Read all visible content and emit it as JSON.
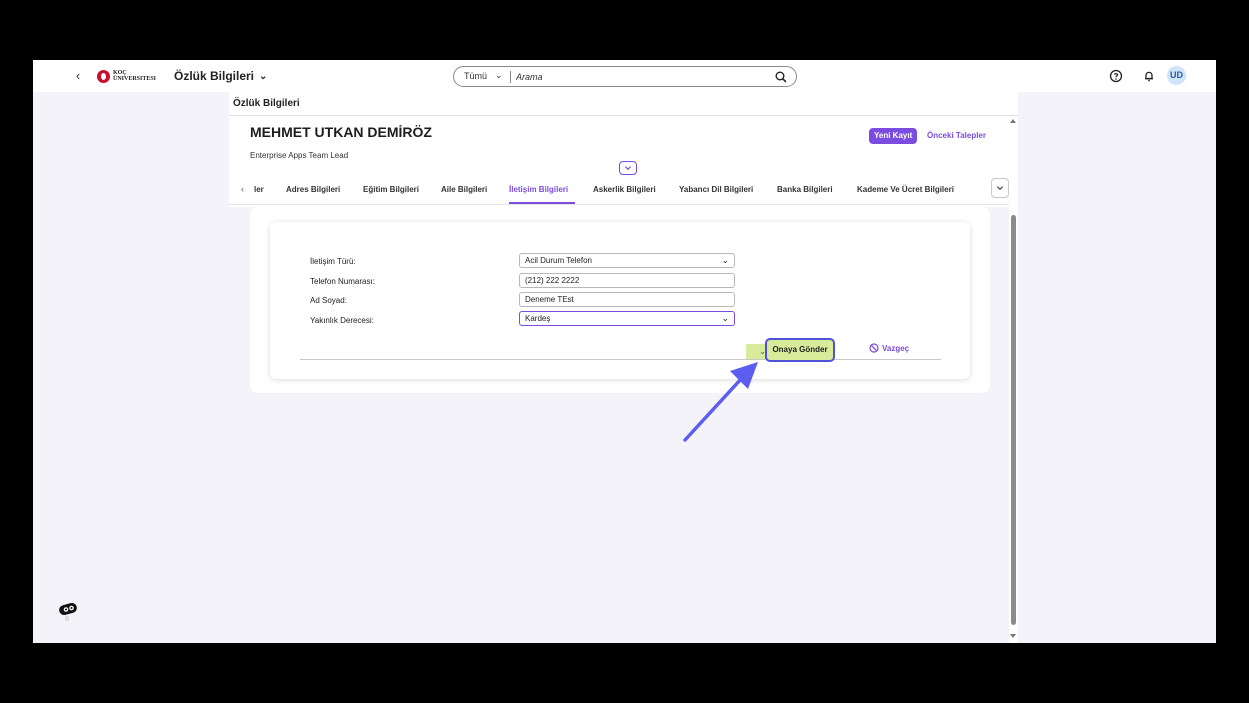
{
  "shell": {
    "back_label": "‹",
    "logo_line1": "KOÇ",
    "logo_line2": "ÜNIVERSITESI",
    "app_title": "Özlük Bilgileri",
    "app_title_chevron": "⌄",
    "search_scope": "Tümü",
    "search_scope_chevron": "⌄",
    "search_placeholder": "Arama",
    "avatar_initials": "UD"
  },
  "page": {
    "title": "Özlük Bilgileri"
  },
  "header": {
    "employee_name": "MEHMET UTKAN DEMİRÖZ",
    "employee_role": "Enterprise Apps Team Lead",
    "new_record_label": "Yeni Kayıt",
    "previous_requests_label": "Önceki Talepler"
  },
  "tabs": {
    "prev_arrow": "‹",
    "partial_label": "ler",
    "items": [
      {
        "label": "Adres Bilgileri"
      },
      {
        "label": "Eğitim Bilgileri"
      },
      {
        "label": "Aile Bilgileri"
      },
      {
        "label": "İletişim Bilgileri",
        "active": true
      },
      {
        "label": "Askerlik Bilgileri"
      },
      {
        "label": "Yabancı Dil Bilgileri"
      },
      {
        "label": "Banka Bilgileri"
      },
      {
        "label": "Kademe Ve Ücret Bilgileri"
      }
    ]
  },
  "form": {
    "fields": [
      {
        "label": "İletişim Türü:",
        "value": "Acil Durum Telefon",
        "type": "select"
      },
      {
        "label": "Telefon Numarası:",
        "value": "(212) 222 2222",
        "type": "input"
      },
      {
        "label": "Ad Soyad:",
        "value": "Deneme TEst",
        "type": "input"
      },
      {
        "label": "Yakınlık Derecesi:",
        "value": "Kardeş",
        "type": "select",
        "focused": true
      }
    ],
    "submit_label": "Onaya Gönder",
    "cancel_label": "Vazgeç"
  },
  "colors": {
    "accent": "#7a4ce0",
    "submit_bg": "#d7eb9b",
    "highlight_border": "#4f52d6",
    "arrow": "#5b5ef0"
  }
}
